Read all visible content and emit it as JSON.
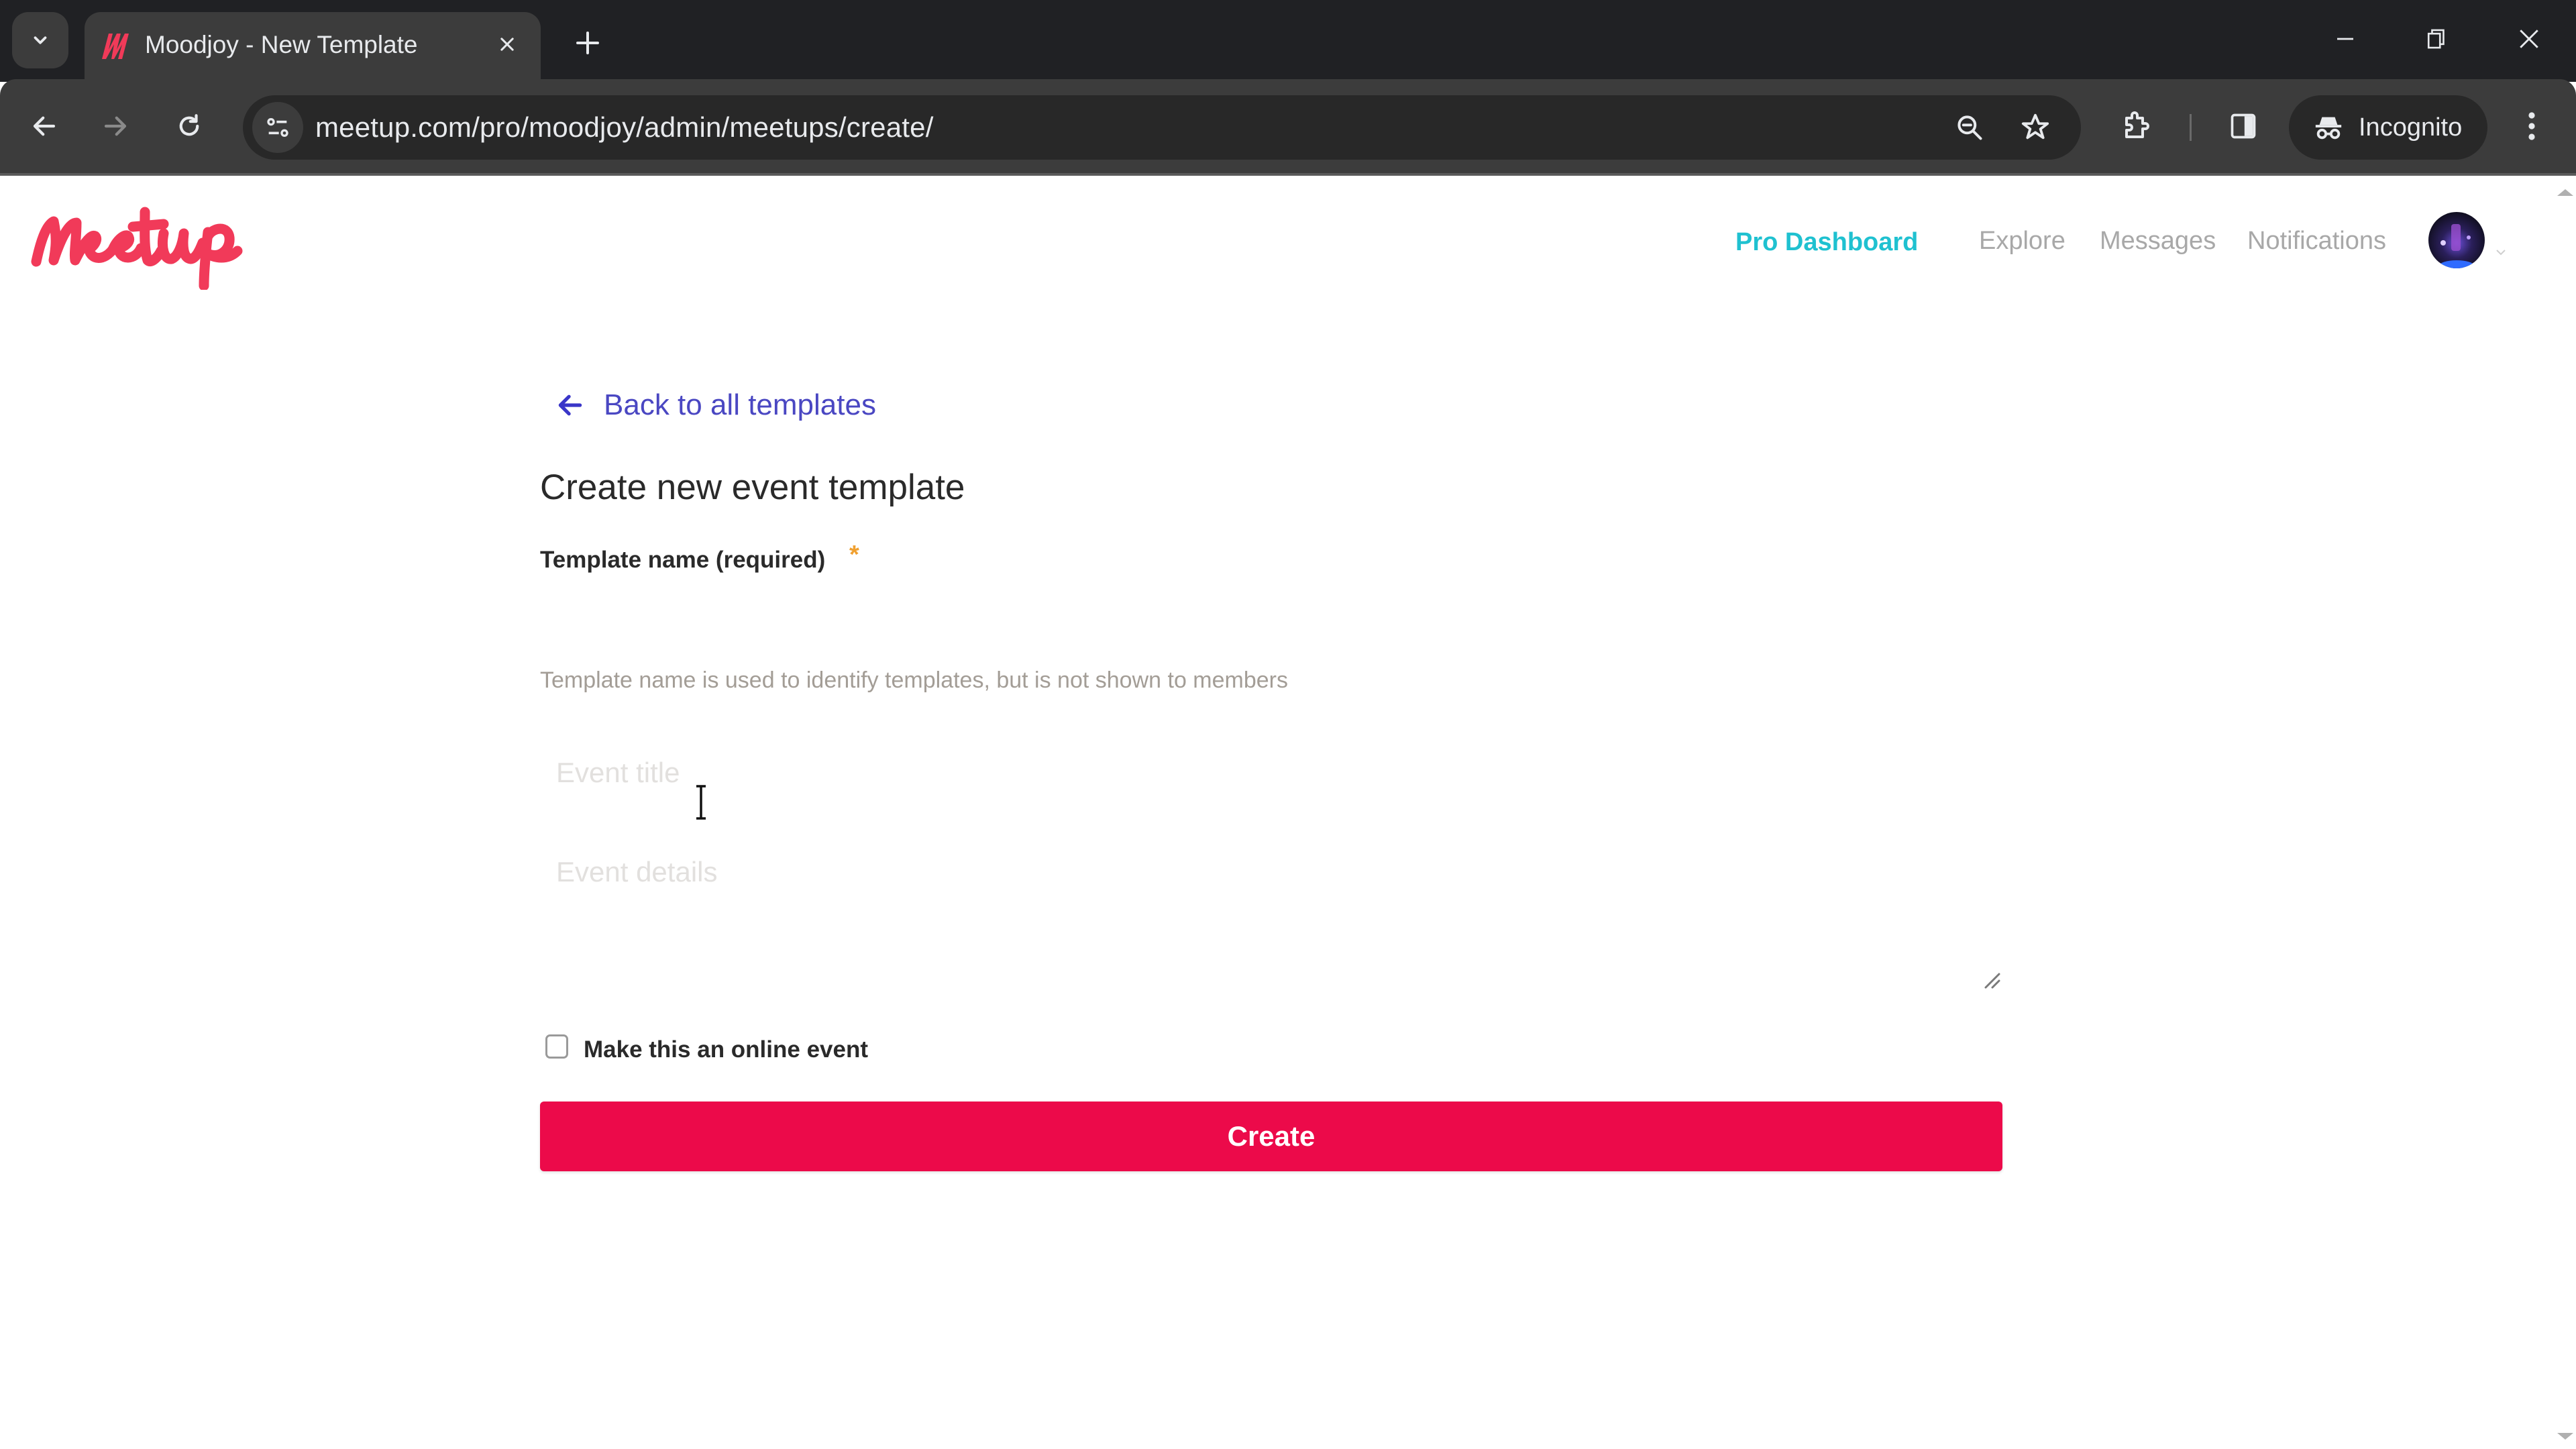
{
  "browser": {
    "tab": {
      "title": "Moodjoy - New Template"
    },
    "url": "meetup.com/pro/moodjoy/admin/meetups/create/",
    "incognito_label": "Incognito",
    "icons": {
      "tab_search": "chevron-down-icon",
      "tab_close": "close-icon",
      "new_tab": "plus-icon",
      "back": "arrow-left-icon",
      "forward": "arrow-right-icon",
      "reload": "reload-icon",
      "site_info": "tune-icon",
      "zoom": "zoom-out-icon",
      "bookmark": "star-icon",
      "extensions": "puzzle-icon",
      "side_panel": "side-panel-icon",
      "incognito": "incognito-icon",
      "menu": "kebab-menu-icon",
      "minimize": "minimize-icon",
      "restore": "restore-icon",
      "close_window": "close-icon"
    }
  },
  "header": {
    "logo_text": "Meetup",
    "nav": [
      {
        "label": "Pro Dashboard",
        "active": true
      },
      {
        "label": "Explore"
      },
      {
        "label": "Messages"
      },
      {
        "label": "Notifications"
      }
    ],
    "brand_color": "#F13A59",
    "pro_color": "#1FC1D0"
  },
  "main": {
    "back_link": "Back to all templates",
    "heading": "Create new event template",
    "template_name": {
      "label": "Template name (required)",
      "required_marker": "*",
      "value": "",
      "helper": "Template name is used to identify templates, but is not shown to members"
    },
    "event_title": {
      "placeholder": "Event title",
      "value": ""
    },
    "event_details": {
      "placeholder": "Event details",
      "value": ""
    },
    "online_event": {
      "label": "Make this an online event",
      "checked": false
    },
    "create_button": "Create",
    "create_color": "#EC0A4A"
  }
}
